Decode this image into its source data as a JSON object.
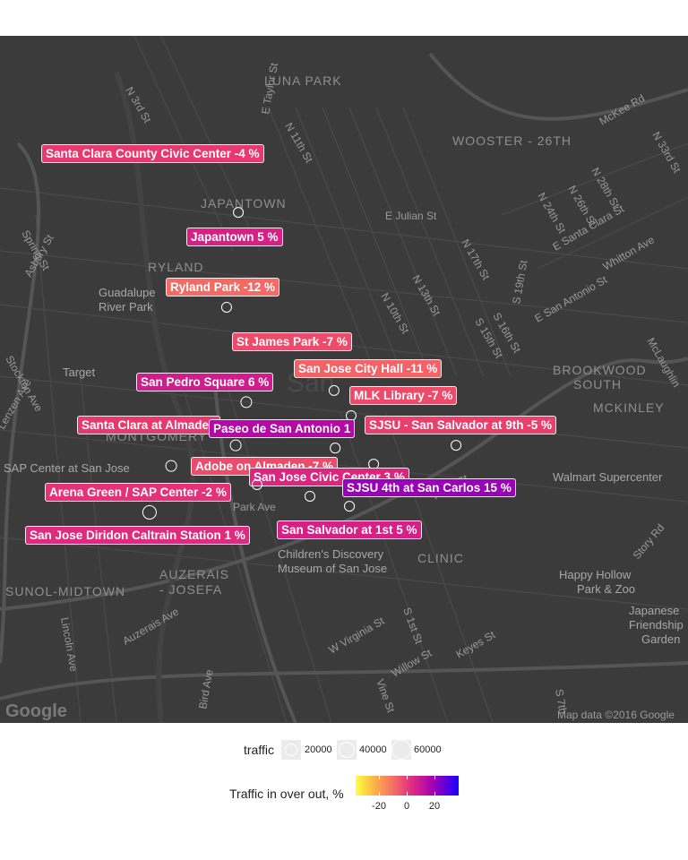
{
  "map": {
    "neighborhoods": [
      "LUNA PARK",
      "WOOSTER - 26TH",
      "JAPANTOWN",
      "RYLAND",
      "BROOKWOOD SOUTH",
      "MCKINLEY",
      "MONTGOMERY",
      "AUZERAIS - JOSEFA",
      "SUNOL-MIDTOWN",
      "CLINIC"
    ],
    "places": [
      "Guadalupe River Park",
      "Target",
      "SAP Center at San Jose",
      "Children's Discovery Museum of San Jose",
      "Happy Hollow Park & Zoo",
      "Japanese Friendship Garden",
      "Walmart Supercenter",
      "Park Ave"
    ],
    "streets": [
      "N 3rd St",
      "N 11th St",
      "N 10th St",
      "N 13th St",
      "N 17th St",
      "E Taylor St",
      "E Julian St",
      "E Santa Clara St",
      "E San Antonio St",
      "Spring St",
      "Asbury St",
      "Stockton Ave",
      "Lenzen Ave",
      "Auzerais Ave",
      "Bird Ave",
      "Lincoln Ave",
      "W Virginia St",
      "Vine St",
      "Willow St",
      "Keyes St",
      "S 1st St",
      "S 7th",
      "Story Rd",
      "McLaughlin",
      "Whitton Ave",
      "McKee Rd",
      "N 33rd St",
      "N 28th St",
      "N 24th St",
      "N 26th St",
      "S 19th St",
      "S 16th St",
      "S 15th St",
      "Reed St"
    ],
    "attribution": "Map data ©2016 Google",
    "logo": "Google"
  },
  "stations": [
    {
      "label": "Santa Clara County Civic Center -4 %",
      "traffic_pct": -4,
      "traffic": 12000,
      "color": "#e8396f"
    },
    {
      "label": "Japantown 5 %",
      "traffic_pct": 5,
      "traffic": 9000,
      "color": "#d81f86"
    },
    {
      "label": "Ryland Park -12 %",
      "traffic_pct": -12,
      "traffic": 10000,
      "color": "#f46a64"
    },
    {
      "label": "St James Park -7 %",
      "traffic_pct": -7,
      "traffic": 12000,
      "color": "#ee4a6a"
    },
    {
      "label": "San Jose City Hall -11 %",
      "traffic_pct": -11,
      "traffic": 11000,
      "color": "#f26266"
    },
    {
      "label": "San Pedro Square 6 %",
      "traffic_pct": 6,
      "traffic": 16000,
      "color": "#d11c8d"
    },
    {
      "label": "MLK Library -7 %",
      "traffic_pct": -7,
      "traffic": 10000,
      "color": "#ee4a6a"
    },
    {
      "label": "Santa Clara at Almaden",
      "traffic_pct": -4,
      "traffic": 14000,
      "color": "#e8396f"
    },
    {
      "label": "Paseo de San Antonio 1",
      "traffic_pct": 10,
      "traffic": 14000,
      "color": "#b608a8"
    },
    {
      "label": "SJSU - San Salvador at 9th -5 %",
      "traffic_pct": -5,
      "traffic": 9000,
      "color": "#ea3e6d"
    },
    {
      "label": "Adobe on Almaden -7 %",
      "traffic_pct": -7,
      "traffic": 8000,
      "color": "#ee4a6a"
    },
    {
      "label": "San Jose Civic Center 3 %",
      "traffic_pct": 3,
      "traffic": 9000,
      "color": "#dd2580"
    },
    {
      "label": "SJSU 4th at San Carlos 15 %",
      "traffic_pct": 15,
      "traffic": 10000,
      "color": "#9a00b8"
    },
    {
      "label": "Arena Green / SAP Center -2 %",
      "traffic_pct": -2,
      "traffic": 10000,
      "color": "#e43277"
    },
    {
      "label": "San Salvador at 1st 5 %",
      "traffic_pct": 5,
      "traffic": 9000,
      "color": "#d81f86"
    },
    {
      "label": "San Jose Diridon Caltrain Station 1 %",
      "traffic_pct": 1,
      "traffic": 40000,
      "color": "#df2b7e"
    }
  ],
  "legend": {
    "size_title": "traffic",
    "size_breaks": [
      "20000",
      "40000",
      "60000"
    ],
    "color_title": "Traffic in over out, %",
    "color_ticks": [
      "-20",
      "0",
      "20"
    ]
  }
}
